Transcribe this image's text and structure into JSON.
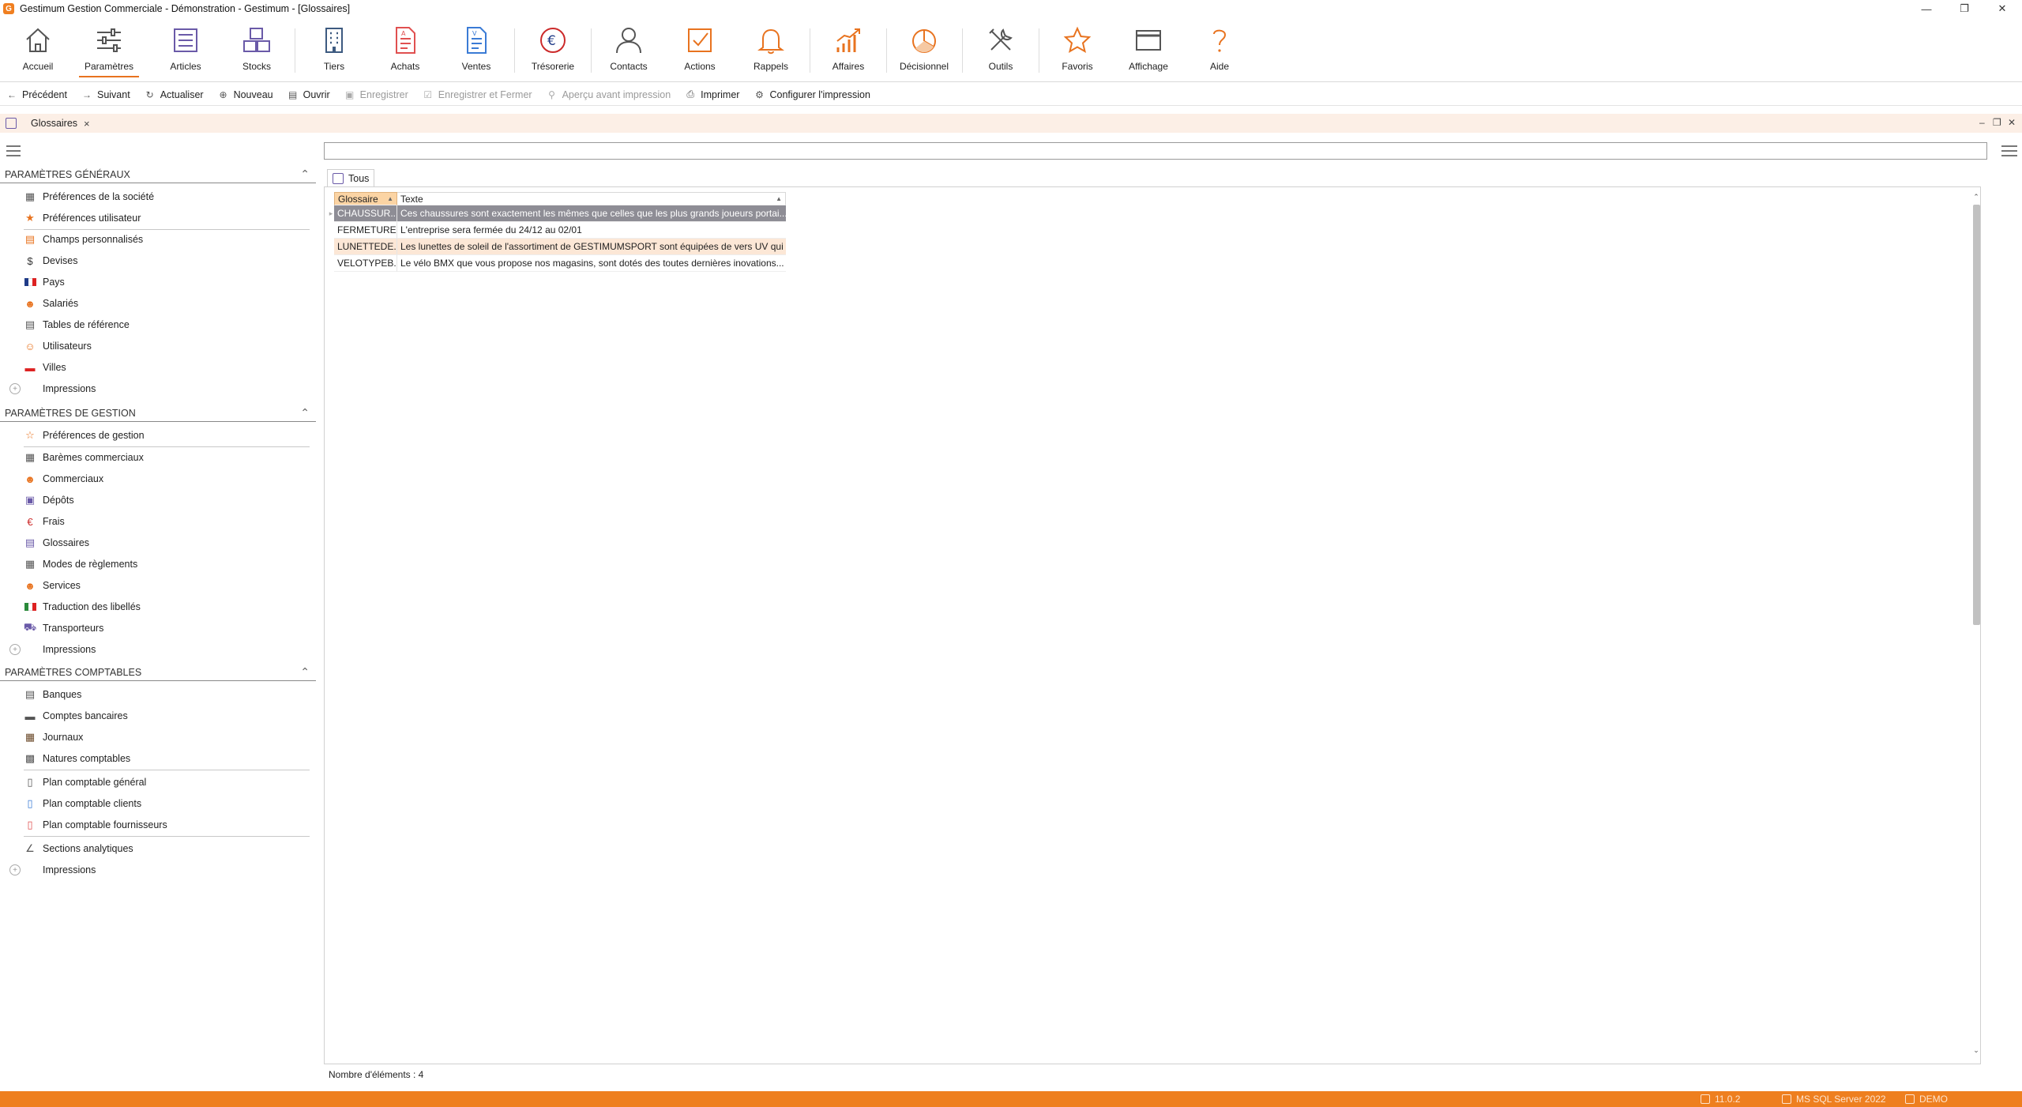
{
  "window": {
    "title": "Gestimum Gestion Commerciale - Démonstration - Gestimum - [Glossaires]",
    "app_icon_letter": "G"
  },
  "ribbon": [
    {
      "label": "Accueil",
      "icon": "home-icon",
      "color": "#555555"
    },
    {
      "label": "Paramètres",
      "icon": "sliders-icon",
      "color": "#555555",
      "active": true
    },
    {
      "label": "Articles",
      "icon": "list-icon",
      "color": "#6a5aa8"
    },
    {
      "label": "Stocks",
      "icon": "boxes-icon",
      "color": "#6a5aa8"
    },
    {
      "label": "Tiers",
      "icon": "building-icon",
      "color": "#3d5a80"
    },
    {
      "label": "Achats",
      "icon": "purchase-doc-icon",
      "color": "#e05050"
    },
    {
      "label": "Ventes",
      "icon": "sales-doc-icon",
      "color": "#3a7bd5"
    },
    {
      "label": "Trésorerie",
      "icon": "euro-icon",
      "color": "#cc2a2a"
    },
    {
      "label": "Contacts",
      "icon": "person-icon",
      "color": "#555555"
    },
    {
      "label": "Actions",
      "icon": "checkbox-icon",
      "color": "#e8731f"
    },
    {
      "label": "Rappels",
      "icon": "bell-icon",
      "color": "#e8731f"
    },
    {
      "label": "Affaires",
      "icon": "growth-chart-icon",
      "color": "#e8731f"
    },
    {
      "label": "Décisionnel",
      "icon": "pie-chart-icon",
      "color": "#e8731f"
    },
    {
      "label": "Outils",
      "icon": "tools-icon",
      "color": "#555555"
    },
    {
      "label": "Favoris",
      "icon": "star-icon",
      "color": "#e8731f"
    },
    {
      "label": "Affichage",
      "icon": "window-icon",
      "color": "#555555"
    },
    {
      "label": "Aide",
      "icon": "question-icon",
      "color": "#e8731f"
    }
  ],
  "toolbar": {
    "precedent": "Précédent",
    "suivant": "Suivant",
    "actualiser": "Actualiser",
    "nouveau": "Nouveau",
    "ouvrir": "Ouvrir",
    "enregistrer": "Enregistrer",
    "enregistrer_fermer": "Enregistrer et Fermer",
    "apercu": "Aperçu avant impression",
    "imprimer": "Imprimer",
    "configurer": "Configurer l'impression"
  },
  "doc_tab": {
    "label": "Glossaires",
    "close": "×"
  },
  "sidebar": {
    "sections": [
      {
        "title": "PARAMÈTRES GÉNÉRAUX",
        "items": [
          {
            "label": "Préférences de la société",
            "icon": "company-prefs-icon"
          },
          {
            "label": "Préférences utilisateur",
            "icon": "user-prefs-icon"
          },
          {
            "label": "Champs personnalisés",
            "icon": "custom-fields-icon"
          },
          {
            "label": "Devises",
            "icon": "dollar-icon"
          },
          {
            "label": "Pays",
            "icon": "flag-icon"
          },
          {
            "label": "Salariés",
            "icon": "employee-icon"
          },
          {
            "label": "Tables de référence",
            "icon": "table-icon"
          },
          {
            "label": "Utilisateurs",
            "icon": "users-icon"
          },
          {
            "label": "Villes",
            "icon": "city-icon"
          }
        ],
        "impressions": "Impressions"
      },
      {
        "title": "PARAMÈTRES DE GESTION",
        "items": [
          {
            "label": "Préférences de gestion",
            "icon": "star-outline-icon"
          },
          {
            "label": "Barèmes commerciaux",
            "icon": "scale-icon"
          },
          {
            "label": "Commerciaux",
            "icon": "salesperson-icon"
          },
          {
            "label": "Dépôts",
            "icon": "warehouse-icon"
          },
          {
            "label": "Frais",
            "icon": "euro-small-icon"
          },
          {
            "label": "Glossaires",
            "icon": "glossary-icon"
          },
          {
            "label": "Modes de règlements",
            "icon": "payment-icon"
          },
          {
            "label": "Services",
            "icon": "service-icon"
          },
          {
            "label": "Traduction des libellés",
            "icon": "translation-flag-icon"
          },
          {
            "label": "Transporteurs",
            "icon": "truck-icon"
          }
        ],
        "impressions": "Impressions"
      },
      {
        "title": "PARAMÈTRES COMPTABLES",
        "items": [
          {
            "label": "Banques",
            "icon": "bank-icon"
          },
          {
            "label": "Comptes bancaires",
            "icon": "bank-account-icon"
          },
          {
            "label": "Journaux",
            "icon": "journal-icon"
          },
          {
            "label": "Natures comptables",
            "icon": "nature-icon"
          },
          {
            "label": "Plan comptable général",
            "icon": "ledger-icon"
          },
          {
            "label": "Plan comptable clients",
            "icon": "client-ledger-icon"
          },
          {
            "label": "Plan comptable fournisseurs",
            "icon": "supplier-ledger-icon"
          },
          {
            "label": "Sections analytiques",
            "icon": "analytics-icon"
          }
        ],
        "impressions": "Impressions"
      }
    ]
  },
  "main": {
    "search_value": "",
    "filter_tab": "Tous",
    "grid": {
      "columns": [
        "Glossaire",
        "Texte"
      ],
      "rows": [
        {
          "code": "CHAUSSUR...",
          "text": "Ces chaussures sont exactement les mêmes que celles que les plus grands joueurs portai...",
          "state": "selected"
        },
        {
          "code": "FERMETURE",
          "text": "L'entreprise sera fermée du 24/12 au 02/01",
          "state": "normal"
        },
        {
          "code": "LUNETTEDE...",
          "text": "Les lunettes de soleil de l'assortiment de GESTIMUMSPORT sont équipées de vers UV qui ...",
          "state": "alt"
        },
        {
          "code": "VELOTYPEB...",
          "text": "Le vélo BMX que vous propose nos magasins, sont dotés des toutes dernières inovations...",
          "state": "normal"
        }
      ]
    },
    "count_label": "Nombre d'éléments : 4"
  },
  "status": {
    "version": "11.0.2",
    "server": "MS SQL Server 2022",
    "db": "DEMO"
  },
  "colors": {
    "accent": "#e8731f",
    "status_bar": "#ee7f1f",
    "tab_bar_bg": "#fcefe6",
    "selected_row": "#8e8d95",
    "alt_row": "#fce7d6"
  }
}
